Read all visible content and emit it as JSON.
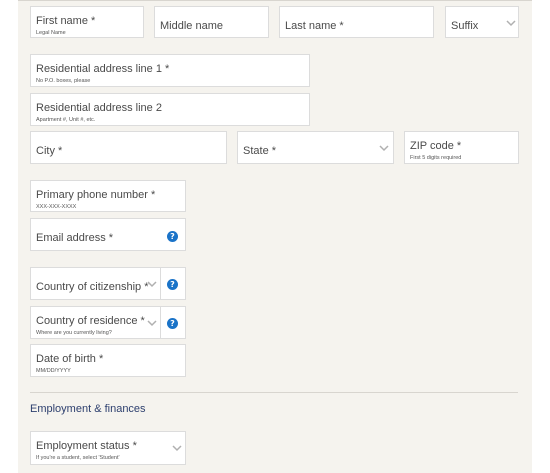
{
  "form": {
    "first_name": {
      "label": "First name *",
      "hint": "Legal Name"
    },
    "middle_name": {
      "label": "Middle name"
    },
    "last_name": {
      "label": "Last name *"
    },
    "suffix": {
      "label": "Suffix"
    },
    "address_line1": {
      "label": "Residential address line 1 *",
      "hint": "No P.O. boxes, please"
    },
    "address_line2": {
      "label": "Residential address line 2",
      "hint": "Apartment #, Unit #, etc."
    },
    "city": {
      "label": "City *"
    },
    "state": {
      "label": "State *"
    },
    "zip": {
      "label": "ZIP code *",
      "hint": "First 5 digits required"
    },
    "phone": {
      "label": "Primary phone number *",
      "hint": "XXX-XXX-XXXX"
    },
    "email": {
      "label": "Email address *"
    },
    "citizenship": {
      "label": "Country of citizenship *"
    },
    "residence": {
      "label": "Country of residence *",
      "hint": "Where are you currently living?"
    },
    "dob": {
      "label": "Date of birth *",
      "hint": "MM/DD/YYYY"
    },
    "employment_status": {
      "label": "Employment status *",
      "hint": "If you're a student, select 'Student'"
    }
  },
  "sections": {
    "employment": "Employment & finances"
  },
  "icons": {
    "help": "question-circle-icon",
    "chevron": "chevron-down-icon"
  },
  "help_glyph": "?",
  "colors": {
    "panel_bg": "#f5f3ee",
    "help_icon": "#1a73c8",
    "section_title": "#2d3f6e"
  }
}
